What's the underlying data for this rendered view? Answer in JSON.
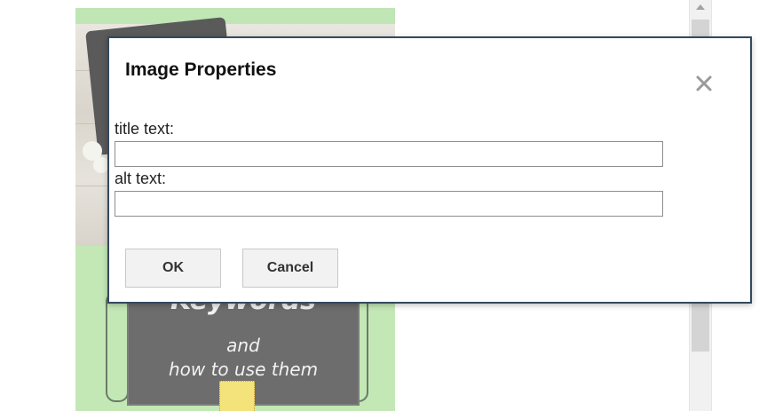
{
  "dialog": {
    "title": "Image Properties",
    "close_icon": "close-icon",
    "title_field": {
      "label": "title text:",
      "value": "",
      "placeholder": ""
    },
    "alt_field": {
      "label": "alt text:",
      "value": "",
      "placeholder": ""
    },
    "ok_label": "OK",
    "cancel_label": "Cancel",
    "border_color": "#34495e"
  },
  "background_image": {
    "board_text_line1": "Keywords",
    "board_text_line2": "and",
    "board_text_line3": "how to use them",
    "background_color": "#bfe6b4"
  },
  "scrollbar": {
    "up_arrow_icon": "chevron-up-icon"
  }
}
